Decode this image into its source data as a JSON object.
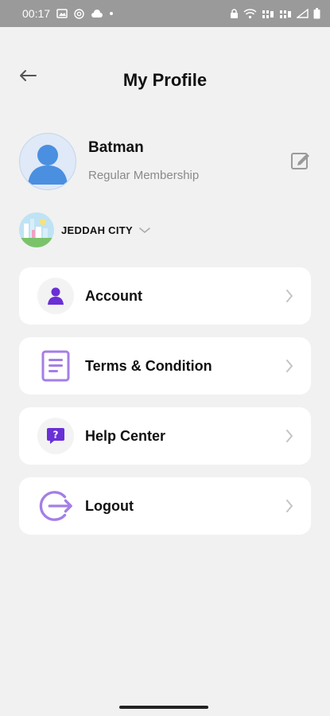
{
  "status_bar": {
    "time": "00:17"
  },
  "header": {
    "title": "My Profile"
  },
  "profile": {
    "name": "Batman",
    "membership": "Regular Membership"
  },
  "city": {
    "name": "JEDDAH CITY"
  },
  "menu": [
    {
      "label": "Account",
      "icon": "person-icon"
    },
    {
      "label": "Terms & Condition",
      "icon": "document-icon"
    },
    {
      "label": "Help Center",
      "icon": "help-chat-icon"
    },
    {
      "label": "Logout",
      "icon": "logout-icon"
    }
  ],
  "colors": {
    "accent": "#6a2fd6",
    "accent_light": "#a47ee6",
    "avatar": "#4a8fe0",
    "background": "#f1f1f1"
  }
}
